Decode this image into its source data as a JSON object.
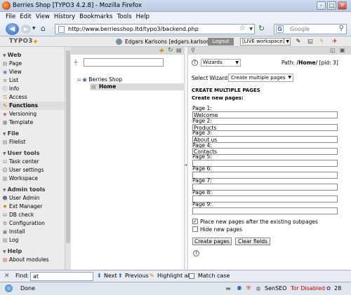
{
  "browser": {
    "title": "Berries Shop [TYPO3 4.2.8] - Mozilla Firefox",
    "menu": [
      "File",
      "Edit",
      "View",
      "History",
      "Bookmarks",
      "Tools",
      "Help"
    ],
    "url": "http://www.berriesshop.ltd/typo3/backend.php",
    "search_placeholder": "Google"
  },
  "typo3": {
    "logo": "TYPO3",
    "user": "Edgars Karlsons [edgars.karlsons]",
    "logout_label": "Logout",
    "workspace": "[LIVE workspace]"
  },
  "nav": {
    "sections": [
      {
        "label": "Web",
        "items": [
          {
            "label": "Page",
            "icon": "page-icon"
          },
          {
            "label": "View",
            "icon": "view-icon"
          },
          {
            "label": "List",
            "icon": "list-icon"
          },
          {
            "label": "Info",
            "icon": "info-icon"
          },
          {
            "label": "Access",
            "icon": "access-icon"
          },
          {
            "label": "Functions",
            "icon": "functions-icon",
            "selected": true
          },
          {
            "label": "Versioning",
            "icon": "versioning-icon"
          },
          {
            "label": "Template",
            "icon": "template-icon"
          }
        ]
      },
      {
        "label": "File",
        "items": [
          {
            "label": "Filelist",
            "icon": "filelist-icon"
          }
        ]
      },
      {
        "label": "User tools",
        "items": [
          {
            "label": "Task center",
            "icon": "task-center-icon"
          },
          {
            "label": "User settings",
            "icon": "user-settings-icon"
          },
          {
            "label": "Workspace",
            "icon": "workspace-icon"
          }
        ]
      },
      {
        "label": "Admin tools",
        "items": [
          {
            "label": "User Admin",
            "icon": "user-admin-icon"
          },
          {
            "label": "Ext Manager",
            "icon": "ext-manager-icon"
          },
          {
            "label": "DB check",
            "icon": "db-check-icon"
          },
          {
            "label": "Configuration",
            "icon": "configuration-icon"
          },
          {
            "label": "Install",
            "icon": "install-icon"
          },
          {
            "label": "Log",
            "icon": "log-icon"
          }
        ]
      },
      {
        "label": "Help",
        "items": [
          {
            "label": "About modules",
            "icon": "about-modules-icon"
          }
        ]
      }
    ]
  },
  "tree": {
    "root": "Berries Shop",
    "child": "Home"
  },
  "content": {
    "wizards_label": "Wizards",
    "path_label": "Path:",
    "path_value": "/Home/",
    "pid": "[pid: 3]",
    "select_wizard_label": "Select Wizard:",
    "select_wizard_value": "Create multiple pages",
    "heading": "CREATE MULTIPLE PAGES",
    "subheading": "Create new pages:",
    "pages": [
      {
        "label": "Page 1:",
        "value": "Welcome"
      },
      {
        "label": "Page 2:",
        "value": "Products"
      },
      {
        "label": "Page 3:",
        "value": "About us"
      },
      {
        "label": "Page 4:",
        "value": "Contacts"
      },
      {
        "label": "Page 5:",
        "value": ""
      },
      {
        "label": "Page 6:",
        "value": ""
      },
      {
        "label": "Page 7:",
        "value": ""
      },
      {
        "label": "Page 8:",
        "value": ""
      },
      {
        "label": "Page 9:",
        "value": ""
      }
    ],
    "checkbox_after": {
      "label": "Place new pages after the existing subpages",
      "checked": true
    },
    "checkbox_hide": {
      "label": "Hide new pages",
      "checked": false
    },
    "create_button": "Create pages",
    "clear_button": "Clear fields"
  },
  "findbar": {
    "label": "Find:",
    "value": "at",
    "next": "Next",
    "previous": "Previous",
    "highlight": "Highlight all",
    "match_case": "Match case"
  },
  "status": {
    "text": "Done",
    "senseo": "SenSEO",
    "tor": "Tor Disabled",
    "count": "28"
  }
}
